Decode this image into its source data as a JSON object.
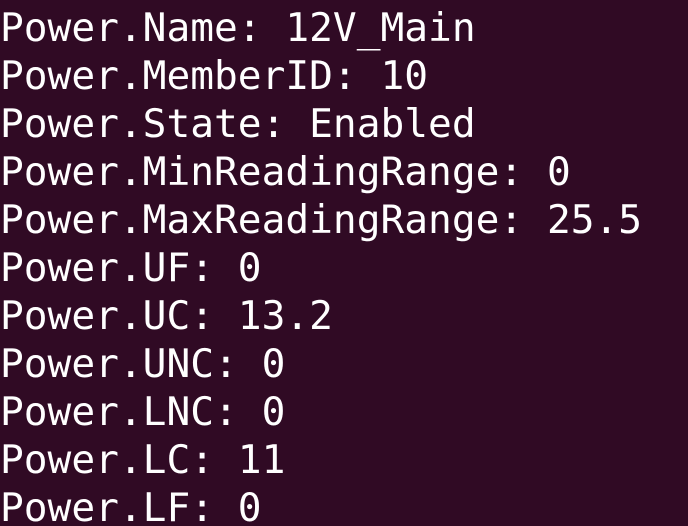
{
  "terminal": {
    "lines": [
      "Power.Name: 12V_Main",
      "Power.MemberID: 10",
      "Power.State: Enabled",
      "Power.MinReadingRange: 0",
      "Power.MaxReadingRange: 25.5",
      "Power.UF: 0",
      "Power.UC: 13.2",
      "Power.UNC: 0",
      "Power.LNC: 0",
      "Power.LC: 11",
      "Power.LF: 0"
    ]
  },
  "colors": {
    "background": "#300a24",
    "text": "#ffffff"
  }
}
